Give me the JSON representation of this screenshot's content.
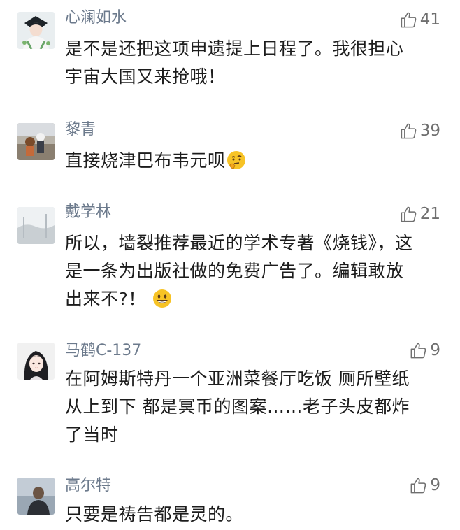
{
  "comments": [
    {
      "username": "心澜如水",
      "likes": "41",
      "avatar_icon": "opera-figure-avatar",
      "lines": [
        "是不是还把这项申遗提上日程了。我很担心",
        "宇宙大国又来抢哦！"
      ]
    },
    {
      "username": "黎青",
      "likes": "39",
      "avatar_icon": "street-photo-avatar",
      "lines": [
        "直接烧津巴布韦元呗"
      ],
      "emoji": "thinking-face-emoji"
    },
    {
      "username": "戴学林",
      "likes": "21",
      "avatar_icon": "misty-landscape-avatar",
      "lines": [
        "所以，墙裂推荐最近的学术专著《烧钱》，这",
        "是一条为出版社做的免费广告了。编辑敢放",
        "出来不?！"
      ],
      "emoji": "grinning-face-emoji"
    },
    {
      "username": "马鹤C-137",
      "likes": "9",
      "avatar_icon": "anime-girl-avatar",
      "lines": [
        "在阿姆斯特丹一个亚洲菜餐厅吃饭 厕所壁纸",
        "从上到下 都是冥币的图案……老子头皮都炸",
        "了当时"
      ]
    },
    {
      "username": "高尔特",
      "likes": "9",
      "avatar_icon": "portrait-photo-avatar",
      "lines": [
        "只要是祷告都是灵的。"
      ]
    }
  ],
  "colors": {
    "username": "#6c7a8c",
    "like_count": "#6f6f6f",
    "text": "#1c1c1c",
    "emoji_yellow": "#f7c326"
  }
}
